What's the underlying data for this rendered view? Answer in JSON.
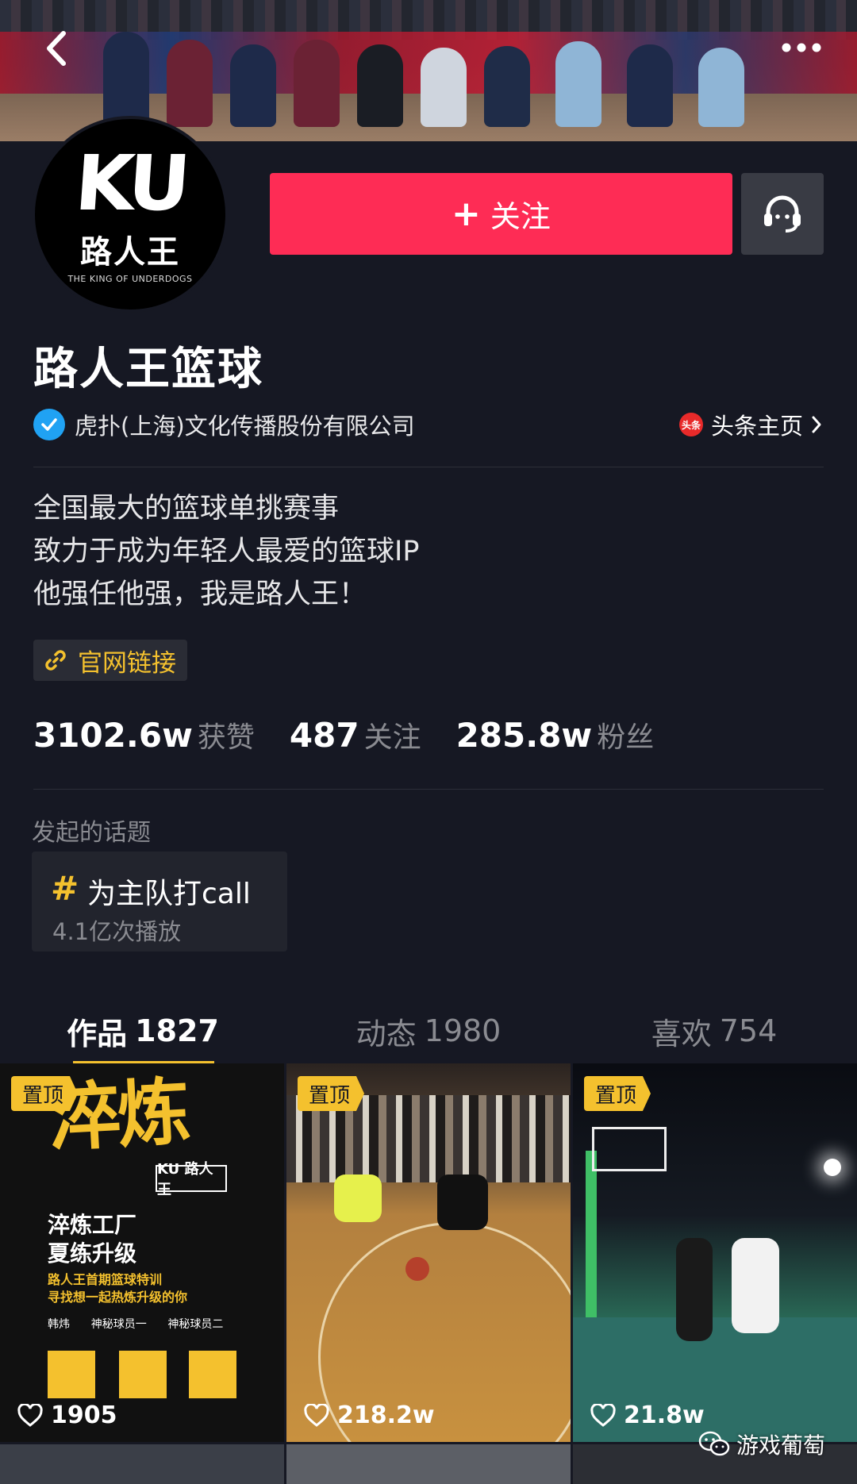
{
  "header": {
    "back_icon": "chevron-left-icon",
    "more_icon": "more-dots-icon"
  },
  "profile": {
    "avatar_letters": "KU",
    "avatar_brand": "路人王",
    "avatar_tagline": "THE KING OF UNDERDOGS",
    "name": "路人王篮球",
    "verified_org": "虎扑(上海)文化传播股份有限公司",
    "toutiao_badge": "头条",
    "toutiao_label": "头条主页",
    "follow_label": "关注",
    "bio_lines": [
      "全国最大的篮球单挑赛事",
      "致力于成为年轻人最爱的篮球IP",
      "他强任他强，我是路人王！"
    ],
    "website_label": "官网链接"
  },
  "stats": [
    {
      "value": "3102.6w",
      "label": "获赞"
    },
    {
      "value": "487",
      "label": "关注"
    },
    {
      "value": "285.8w",
      "label": "粉丝"
    }
  ],
  "topics": {
    "title": "发起的话题",
    "items": [
      {
        "name": "为主队打call",
        "plays": "4.1亿次播放"
      }
    ]
  },
  "tabs": [
    {
      "label": "作品",
      "count": "1827",
      "active": true
    },
    {
      "label": "动态",
      "count": "1980",
      "active": false
    },
    {
      "label": "喜欢",
      "count": "754",
      "active": false
    }
  ],
  "videos": [
    {
      "pinned_label": "置顶",
      "likes": "1905",
      "poster_title": "淬炼",
      "poster_logo": "KU 路人王",
      "poster_headline": "淬炼工厂\n夏练升级",
      "poster_sub": "路人王首期篮球特训\n寻找想一起热炼升级的你",
      "poster_names": "韩炜      神秘球员一      神秘球员二"
    },
    {
      "pinned_label": "置顶",
      "likes": "218.2w"
    },
    {
      "pinned_label": "置顶",
      "likes": "21.8w"
    }
  ],
  "watermark": "游戏葡萄",
  "colors": {
    "accent": "#fe2c55",
    "gold": "#f4c12e",
    "bg": "#161823",
    "verify": "#20a2f3"
  }
}
